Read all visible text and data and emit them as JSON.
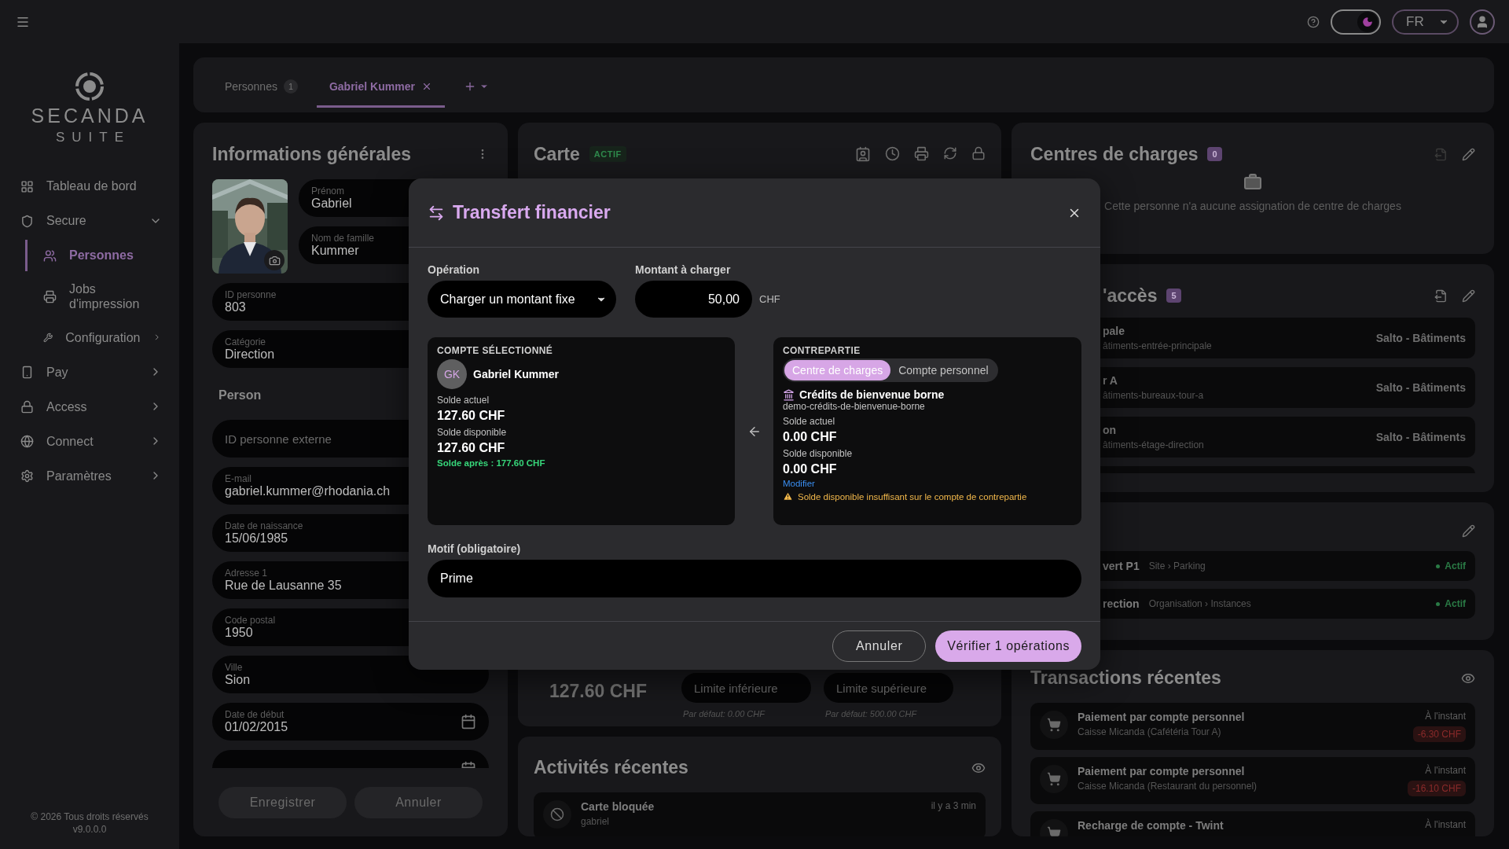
{
  "topbar": {
    "dark_mode": true,
    "language": "FR"
  },
  "sidebar": {
    "brand": "SECANDA",
    "brand_sub": "SUITE",
    "nav": [
      {
        "label": "Tableau de bord",
        "kind": "link",
        "selected": false
      },
      {
        "label": "Secure",
        "kind": "group",
        "expanded": true,
        "selected": false,
        "children": [
          {
            "label": "Personnes",
            "kind": "link",
            "selected": true
          },
          {
            "label": "Jobs d'impression",
            "kind": "link",
            "selected": false
          },
          {
            "label": "Configuration",
            "kind": "group",
            "expanded": false,
            "selected": false
          }
        ]
      },
      {
        "label": "Pay",
        "kind": "group",
        "expanded": false,
        "selected": false
      },
      {
        "label": "Access",
        "kind": "group",
        "expanded": false,
        "selected": false
      },
      {
        "label": "Connect",
        "kind": "group",
        "expanded": false,
        "selected": false
      },
      {
        "label": "Paramètres",
        "kind": "group",
        "expanded": false,
        "selected": false
      }
    ],
    "footer": [
      "© 2026 Tous droits réservés",
      "v9.0.0.0"
    ]
  },
  "tabs": [
    {
      "label": "Personnes",
      "count": "1",
      "selected": false,
      "closable": false
    },
    {
      "label": "Gabriel Kummer",
      "selected": true,
      "closable": true
    }
  ],
  "general": {
    "title": "Informations générales",
    "name_fields": [
      {
        "label": "Prénom",
        "value": "Gabriel"
      },
      {
        "label": "Nom de famille",
        "value": "Kummer"
      }
    ],
    "fields": [
      {
        "label": "ID personne",
        "value": "803",
        "kind": "text"
      },
      {
        "label": "Catégorie",
        "value": "Direction",
        "kind": "text"
      },
      {
        "kind": "section",
        "title": "Person"
      },
      {
        "placeholder": "ID personne externe",
        "kind": "text"
      },
      {
        "label": "E-mail",
        "value": "gabriel.kummer@rhodania.ch",
        "kind": "text"
      },
      {
        "label": "Date de naissance",
        "value": "15/06/1985",
        "kind": "text"
      },
      {
        "label": "Adresse 1",
        "value": "Rue de Lausanne 35",
        "kind": "text"
      },
      {
        "label": "Code postal",
        "value": "1950",
        "kind": "text"
      },
      {
        "label": "Ville",
        "value": "Sion",
        "kind": "text"
      },
      {
        "label": "Date de début",
        "value": "01/02/2015",
        "kind": "date"
      },
      {
        "kind": "date"
      }
    ],
    "buttons": [
      {
        "label": "Enregistrer",
        "disabled": true
      },
      {
        "label": "Annuler",
        "disabled": true
      }
    ]
  },
  "card": {
    "title": "Carte",
    "status": "ACTIF",
    "balance": "127.60 CHF",
    "limits": [
      {
        "placeholder": "Limite inférieure",
        "hint": "Par défaut: 0.00 CHF"
      },
      {
        "placeholder": "Limite supérieure",
        "hint": "Par défaut: 500.00 CHF"
      }
    ]
  },
  "activities": {
    "title": "Activités récentes",
    "items": [
      {
        "title": "Carte bloquée",
        "user": "gabriel",
        "time": "il y a 3 min"
      }
    ]
  },
  "cost_centers": {
    "title": "Centres de charges",
    "count": "0",
    "empty": "Cette personne n'a aucune assignation de centre de charges"
  },
  "access": {
    "title": "'accès",
    "count": "5",
    "rows": [
      {
        "name": "pale",
        "code": "âtiments-entrée-principale",
        "system": "Salto - Bâtiments"
      },
      {
        "name": "r A",
        "code": "âtiments-bureaux-tour-a",
        "system": "Salto - Bâtiments"
      },
      {
        "name": "on",
        "code": "âtiments-étage-direction",
        "system": "Salto - Bâtiments"
      }
    ]
  },
  "assignments": {
    "rows": [
      {
        "name": "vert P1",
        "path": "Site › Parking",
        "status": "Actif"
      },
      {
        "name": "rection",
        "path": "Organisation › Instances",
        "status": "Actif"
      }
    ]
  },
  "transactions": {
    "title": "Transactions récentes",
    "rows": [
      {
        "title": "Paiement par compte personnel",
        "subtitle": "Caisse Micanda (Cafétéria Tour A)",
        "time": "À l'instant",
        "amount": "-6.30 CHF"
      },
      {
        "title": "Paiement par compte personnel",
        "subtitle": "Caisse Micanda (Restaurant du personnel)",
        "time": "À l'instant",
        "amount": "-16.10 CHF"
      },
      {
        "title": "Recharge de compte - Twint",
        "time": "À l'instant"
      }
    ]
  },
  "modal": {
    "title": "Transfert financier",
    "operation": {
      "label": "Opération",
      "value": "Charger un montant fixe"
    },
    "amount": {
      "label": "Montant à charger",
      "value": "50,00",
      "unit": "CHF"
    },
    "account": {
      "heading": "COMPTE SÉLECTIONNÉ",
      "initials": "GK",
      "name": "Gabriel Kummer",
      "current_label": "Solde actuel",
      "current": "127.60 CHF",
      "available_label": "Solde disponible",
      "available": "127.60 CHF",
      "after": "Solde après : 177.60 CHF"
    },
    "counterpart": {
      "heading": "CONTREPARTIE",
      "options": [
        {
          "label": "Centre de charges",
          "selected": true
        },
        {
          "label": "Compte personnel",
          "selected": false
        }
      ],
      "name": "Crédits de bienvenue borne",
      "code": "demo-crédits-de-bienvenue-borne",
      "current_label": "Solde actuel",
      "current": "0.00 CHF",
      "available_label": "Solde disponible",
      "available": "0.00 CHF",
      "link": "Modifier",
      "warning": "Solde disponible insuffisant sur le compte de contrepartie"
    },
    "reason": {
      "label": "Motif (obligatoire)",
      "value": "Prime"
    },
    "buttons": [
      {
        "label": "Annuler",
        "kind": "secondary"
      },
      {
        "label": "Vérifier 1 opérations",
        "kind": "primary"
      }
    ]
  }
}
